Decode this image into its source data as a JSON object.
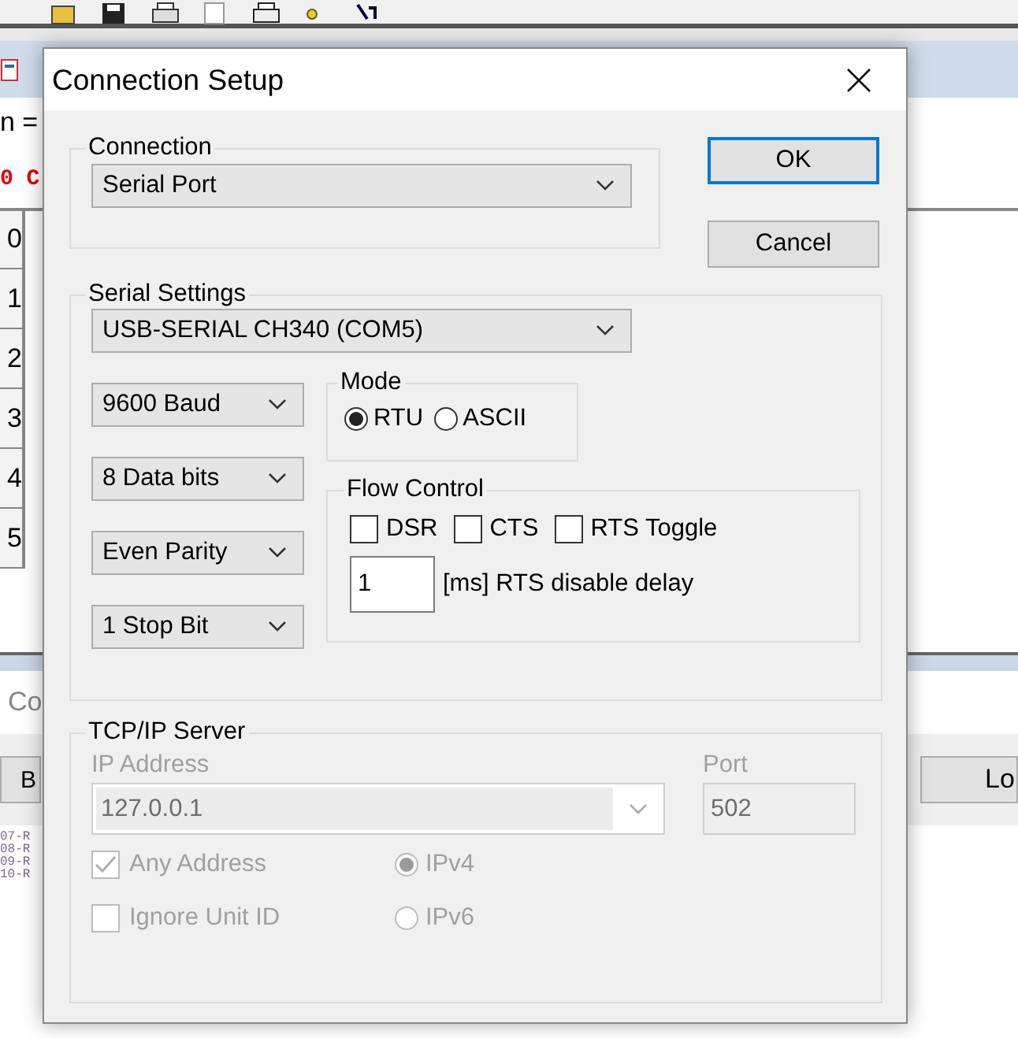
{
  "background_app": {
    "lines": [
      {
        "text": "n =",
        "kind": "plain"
      },
      {
        "text": "0 C",
        "kind": "alert"
      }
    ],
    "row_numbers": [
      "0",
      "1",
      "2",
      "3",
      "4",
      "5"
    ],
    "panel_label": "Co",
    "buttons": [
      "B",
      "Lo"
    ],
    "log_lines": [
      "07-R",
      "08-R",
      "09-R",
      "10-R"
    ]
  },
  "dialog": {
    "title": "Connection Setup",
    "connection": {
      "label": "Connection",
      "value": "Serial Port"
    },
    "buttons": [
      {
        "label": "OK",
        "default": true
      },
      {
        "label": "Cancel",
        "default": false
      }
    ],
    "serial_settings": {
      "label": "Serial Settings",
      "port": "USB-SERIAL CH340 (COM5)",
      "options": [
        "9600 Baud",
        "8 Data bits",
        "Even Parity",
        "1 Stop Bit"
      ],
      "mode": {
        "label": "Mode",
        "options": [
          {
            "label": "RTU",
            "selected": true
          },
          {
            "label": "ASCII",
            "selected": false
          }
        ]
      },
      "flow_control": {
        "label": "Flow Control",
        "options": [
          {
            "label": "DSR",
            "checked": false
          },
          {
            "label": "CTS",
            "checked": false
          },
          {
            "label": "RTS Toggle",
            "checked": false
          }
        ],
        "delay_value": "1",
        "delay_label": "[ms] RTS disable delay"
      }
    },
    "tcp_ip_server": {
      "label": "TCP/IP Server",
      "disabled": true,
      "ip_label": "IP Address",
      "ip_value": "127.0.0.1",
      "port_label": "Port",
      "port_value": "502",
      "checkboxes": [
        {
          "label": "Any Address",
          "checked": true
        },
        {
          "label": "Ignore Unit ID",
          "checked": false
        }
      ],
      "ip_versions": [
        {
          "label": "IPv4",
          "selected": true
        },
        {
          "label": "IPv6",
          "selected": false
        }
      ]
    }
  }
}
